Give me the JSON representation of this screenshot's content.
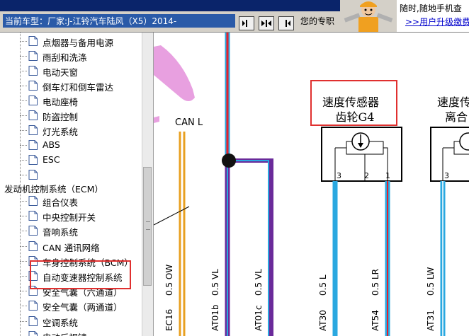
{
  "toolbar": {
    "model_prefix": "当前车型：",
    "model_name": "厂家:J-江铃汽车陆风（X5）2014-",
    "promo_text": "您的专职",
    "nav_buttons": [
      "nav-left",
      "nav-split",
      "nav-right"
    ]
  },
  "ad": {
    "line1": "随时,随地手机查",
    "link": ">>用户升级缴费"
  },
  "sidebar": {
    "items_top": [
      "点烟器与备用电源",
      "雨刮和洗涤",
      "电动天窗",
      "倒车灯和倒车雷达",
      "电动座椅",
      "防盗控制",
      "灯光系统",
      "ABS",
      "ESC",
      ""
    ],
    "group_label": "发动机控制系统（ECM）",
    "items_bottom": [
      "组合仪表",
      "中央控制开关",
      "音响系统",
      "CAN 通讯网络",
      "车身控制系统（BCM）",
      "自动变速器控制系统",
      "安全气囊（六通道）",
      "安全气囊（两通道）",
      "空调系统",
      "电动后视镜"
    ],
    "selected": "自动变速器控制系统"
  },
  "diagram": {
    "can_label": "CAN L",
    "sensor1": {
      "line1": "速度传感器",
      "line2": "齿轮G4",
      "pins": [
        "3",
        "2",
        "1"
      ]
    },
    "sensor2": {
      "line1": "速度传",
      "line2": "离合",
      "pins": [
        "3"
      ]
    },
    "wires": [
      {
        "code": "EC16",
        "spec": "0.5 OW"
      },
      {
        "code": "AT01b",
        "spec": "0.5 VL"
      },
      {
        "code": "AT01c",
        "spec": "0.5 VL"
      },
      {
        "code": "AT30",
        "spec": "0.5 L"
      },
      {
        "code": "AT54",
        "spec": "0.5 LR"
      },
      {
        "code": "AT31",
        "spec": "0.5 LW"
      }
    ],
    "colors": {
      "red": "#e8202a",
      "purple": "#6a2a9a",
      "blue": "#2aa8e0",
      "orange": "#e8a020",
      "pink": "#e8a0e0",
      "highlight": "#e0302f"
    }
  }
}
